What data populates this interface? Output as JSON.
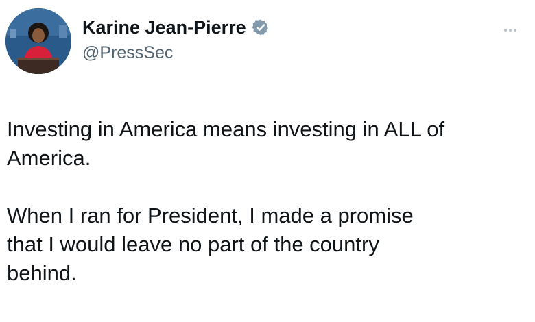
{
  "tweet": {
    "author": {
      "display_name": "Karine Jean-Pierre",
      "handle": "@PressSec",
      "verified": true,
      "avatar_icon": "profile-photo",
      "verified_icon": "verified-badge-icon"
    },
    "more_icon": "more-options-icon",
    "body": {
      "paragraph_1": "Investing in America means investing in ALL of\nAmerica.",
      "paragraph_2": "When I ran for President, I made a promise\nthat I would leave no part of the country\nbehind."
    }
  },
  "colors": {
    "text_primary": "#0f1419",
    "text_secondary": "#536471",
    "verified_badge": "#829aab",
    "background": "#ffffff"
  }
}
